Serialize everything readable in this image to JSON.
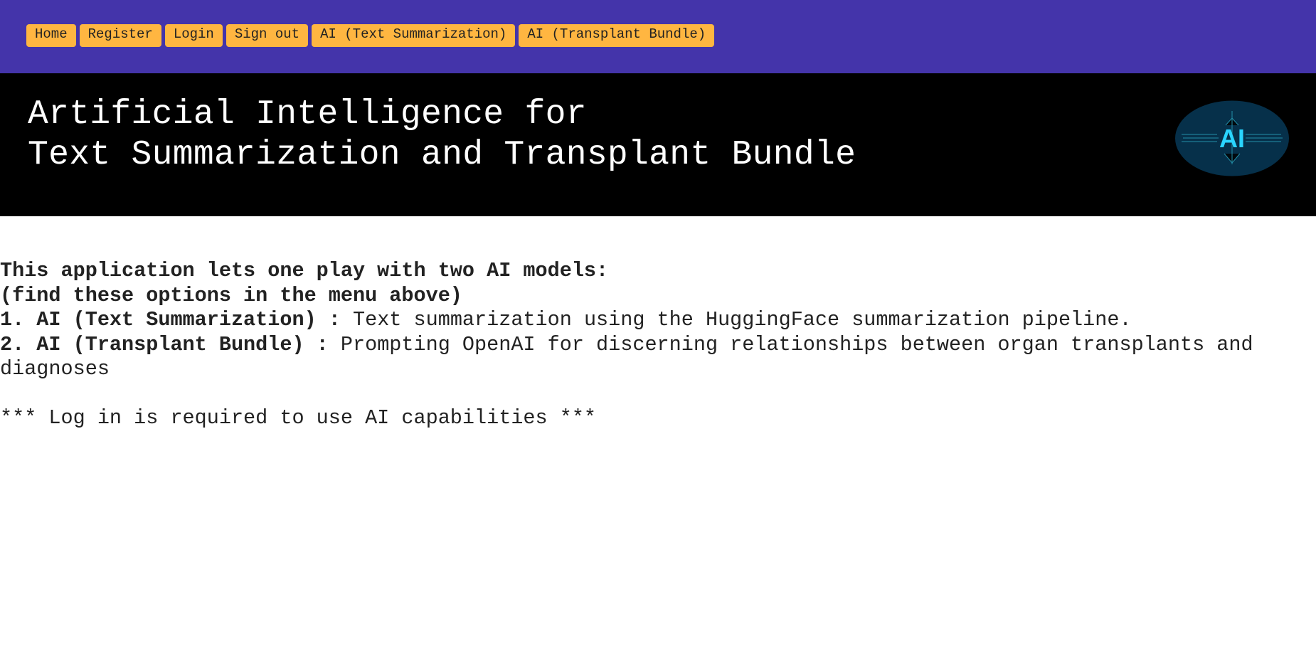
{
  "nav": {
    "items": [
      "Home",
      "Register",
      "Login",
      "Sign out",
      "AI (Text Summarization)",
      "AI (Transplant Bundle)"
    ]
  },
  "banner": {
    "title_line1": "Artificial Intelligence for",
    "title_line2": "Text Summarization and Transplant Bundle",
    "logo_text": "AI"
  },
  "content": {
    "intro": "This application lets one play with two AI models:",
    "hint": "(find these options in the menu above)",
    "item1_label": "1. AI (Text Summarization) :",
    "item1_text": " Text summarization using the HuggingFace summarization pipeline.",
    "item2_label": "2. AI (Transplant Bundle) :",
    "item2_text": " Prompting OpenAI for discerning relationships between organ transplants and diagnoses",
    "notice": "*** Log in is required to use AI capabilities ***"
  }
}
